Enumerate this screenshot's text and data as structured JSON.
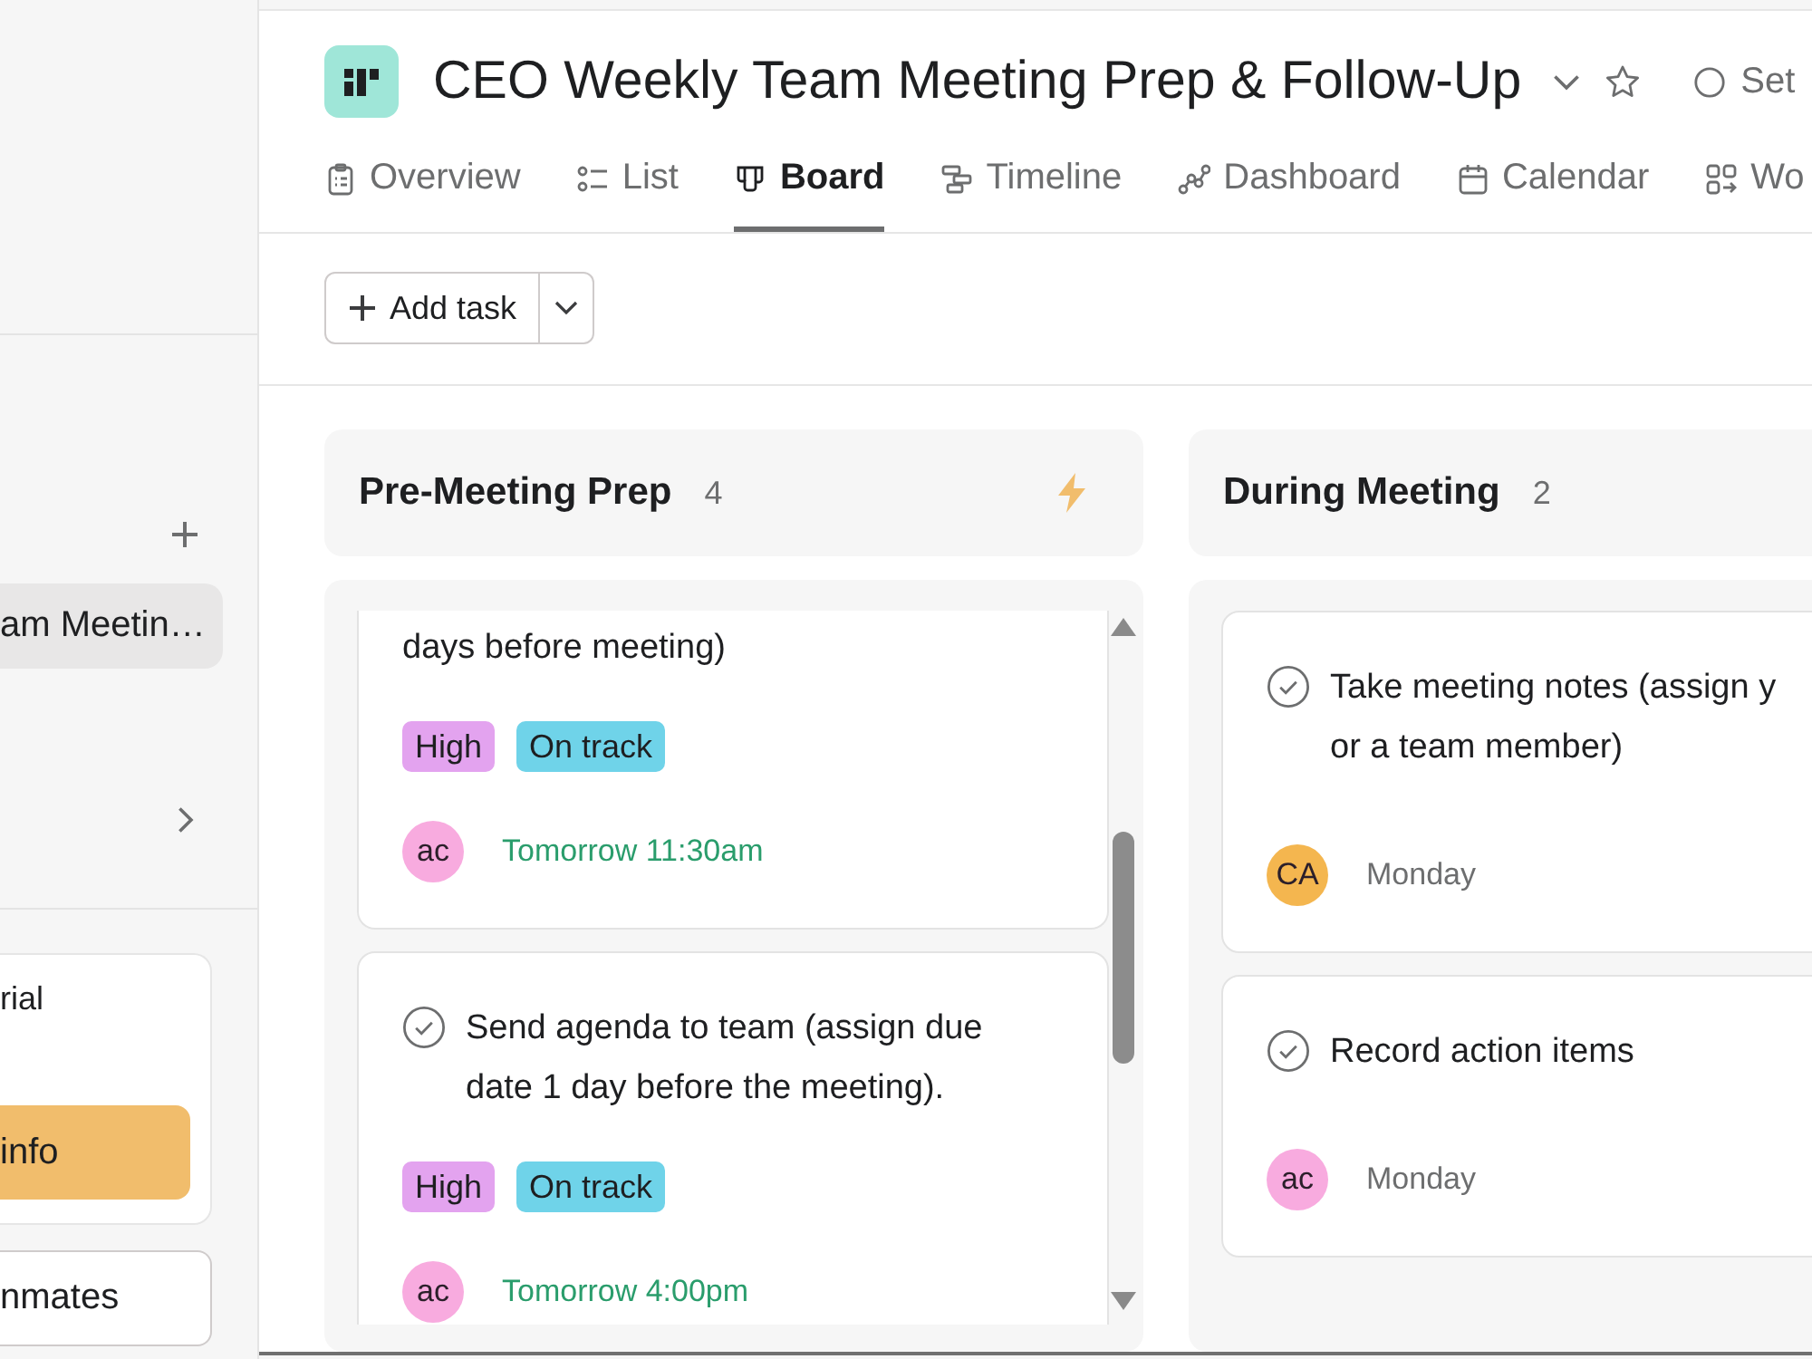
{
  "sidebar": {
    "items": [
      {
        "label": "am Meetin…",
        "selected": true
      }
    ],
    "card": {
      "text": "rial",
      "button": "info"
    },
    "button": "nmates"
  },
  "header": {
    "title": "CEO Weekly Team Meeting Prep & Follow-Up",
    "status_button": "Set"
  },
  "tabs": [
    {
      "label": "Overview",
      "selected": false
    },
    {
      "label": "List",
      "selected": false
    },
    {
      "label": "Board",
      "selected": true
    },
    {
      "label": "Timeline",
      "selected": false
    },
    {
      "label": "Dashboard",
      "selected": false
    },
    {
      "label": "Calendar",
      "selected": false
    },
    {
      "label": "Wo",
      "selected": false
    }
  ],
  "toolbar": {
    "add_button": "Add task"
  },
  "board": {
    "columns": [
      {
        "title": "Pre-Meeting Prep",
        "count": "4",
        "automation": true,
        "scrollable": true,
        "cards": [
          {
            "cut_top": true,
            "title": "days before meeting)",
            "tags": [
              {
                "label": "High",
                "color": "#e3a3ef"
              },
              {
                "label": "On track",
                "color": "#6fd3e9"
              }
            ],
            "assignee": {
              "initials": "ac",
              "color": "#f8abdf"
            },
            "due": {
              "text": "Tomorrow 11:30am",
              "color": "#2a9d6c"
            }
          },
          {
            "cut_top": false,
            "completed": false,
            "title": "Send agenda to team (assign due\ndate 1 day before the meeting).",
            "tags": [
              {
                "label": "High",
                "color": "#e3a3ef"
              },
              {
                "label": "On track",
                "color": "#6fd3e9"
              }
            ],
            "assignee": {
              "initials": "ac",
              "color": "#f8abdf"
            },
            "due": {
              "text": "Tomorrow 4:00pm",
              "color": "#2a9d6c"
            }
          }
        ]
      },
      {
        "title": "During Meeting",
        "count": "2",
        "cards": [
          {
            "cut_top": false,
            "completed": false,
            "title": "Take meeting notes (assign y\nor a team member)",
            "assignee": {
              "initials": "CA",
              "color": "#f4b64f"
            },
            "due": {
              "text": "Monday",
              "color": "#6d6e6f"
            }
          },
          {
            "cut_top": false,
            "completed": false,
            "title": "Record action items",
            "assignee": {
              "initials": "ac",
              "color": "#f8abdf"
            },
            "due": {
              "text": "Monday",
              "color": "#6d6e6f"
            }
          }
        ]
      }
    ]
  }
}
